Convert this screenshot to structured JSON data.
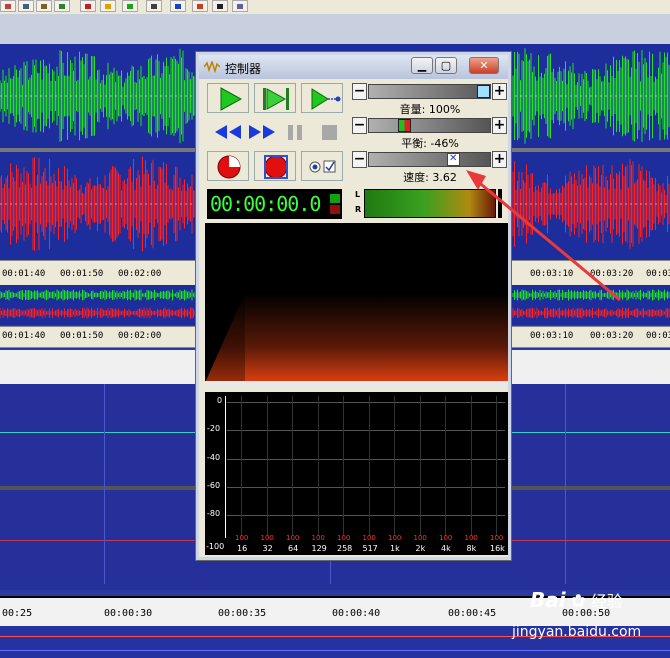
{
  "window": {
    "title": "控制器",
    "icon": "waveform-icon"
  },
  "transport": {
    "play_icon": "play-icon",
    "play_loop_icon": "play-loop-icon",
    "play_to_cursor_icon": "play-cursor-icon",
    "rewind_icon": "rewind-icon",
    "fast_forward_icon": "fast-forward-icon",
    "pause_icon": "pause-icon",
    "stop_icon": "stop-icon",
    "record_icon": "record-icon",
    "record_pause_icon": "record-stop-icon"
  },
  "sliders": {
    "volume": {
      "label": "音量: 100%",
      "level": 1.0
    },
    "balance": {
      "label": "平衡: -46%",
      "level": -0.46
    },
    "speed": {
      "label": "速度: 3.62",
      "level": 0.72
    }
  },
  "time_display": "00:00:00.0",
  "meter": {
    "left": "L",
    "right": "R"
  },
  "analyzer": {
    "db_labels": [
      "0",
      "-20",
      "-40",
      "-60",
      "-80",
      "-100"
    ],
    "values": [
      "100",
      "100",
      "100",
      "100",
      "100",
      "100",
      "100",
      "100",
      "100",
      "100",
      "100"
    ],
    "freqs": [
      "16",
      "32",
      "64",
      "129",
      "258",
      "517",
      "1k",
      "2k",
      "4k",
      "8k",
      "16k"
    ]
  },
  "rulers": {
    "upper": [
      "00:01:40",
      "00:01:50",
      "00:02:00",
      "00:03:10",
      "00:03:20",
      "00:03:"
    ],
    "middle": [
      "00:01:40",
      "00:01:50",
      "00:02:00",
      "00:03:10",
      "00:03:20",
      "00:03:"
    ],
    "bottom": [
      "00:25",
      "00:00:30",
      "00:00:35",
      "00:00:40",
      "00:00:45",
      "00:00:50"
    ]
  },
  "watermark": {
    "brand": "Bai",
    "brand2": "经验",
    "url": "jingyan.baidu.com"
  },
  "colors": {
    "wave_left": "#22e022",
    "wave_right": "#ff2020",
    "wave_bg": "#1e2d9c",
    "time_text": "#3cff3c"
  }
}
